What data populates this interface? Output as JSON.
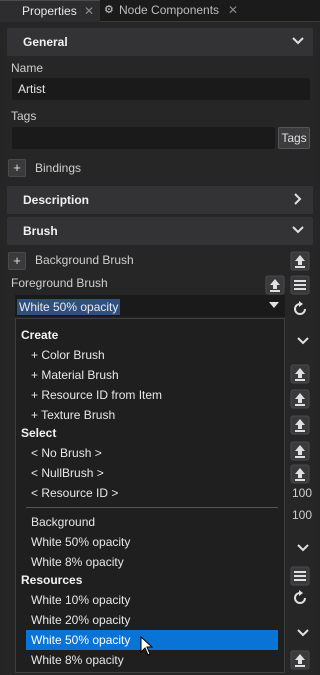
{
  "tabs": [
    {
      "label": "Properties"
    },
    {
      "label": "Node Components"
    }
  ],
  "sections": {
    "general": "General",
    "description": "Description",
    "brush": "Brush"
  },
  "fields": {
    "name_label": "Name",
    "name_value": "Artist",
    "tags_label": "Tags",
    "tags_value": "",
    "tags_button": "Tags",
    "bindings_label": "Bindings",
    "background_brush_label": "Background Brush",
    "foreground_brush_label": "Foreground Brush",
    "foreground_brush_value": "White 50% opacity"
  },
  "side_values": {
    "v1": "100",
    "v2": "100"
  },
  "dropdown": {
    "create_header": "Create",
    "create_items": [
      "+ Color Brush",
      "+ Material Brush",
      "+ Resource ID from Item",
      "+ Texture Brush"
    ],
    "select_header": "Select",
    "select_items": [
      "< No Brush >",
      "< NullBrush >",
      "< Resource ID >"
    ],
    "recent_items": [
      "Background",
      "White 50% opacity",
      "White 8% opacity"
    ],
    "resources_header": "Resources",
    "resources_items": [
      "White 10% opacity",
      "White 20% opacity",
      "White 50% opacity",
      "White 8% opacity"
    ],
    "selected_index": 2
  },
  "colors": {
    "accent": "#0a74d6",
    "panel": "#262627",
    "section": "#333335"
  },
  "icons": [
    "close-icon",
    "node-components-icon",
    "chevron-down-icon",
    "chevron-right-icon",
    "plus-icon",
    "upload-icon",
    "reset-icon",
    "list-icon",
    "cursor-icon"
  ]
}
